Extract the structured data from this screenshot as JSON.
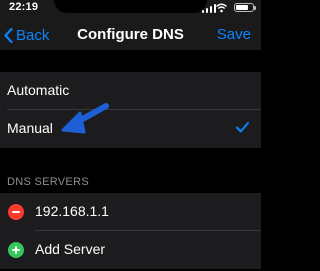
{
  "status_bar": {
    "time": "22:19"
  },
  "nav": {
    "back_label": "Back",
    "title": "Configure DNS",
    "save_label": "Save"
  },
  "dns_mode": {
    "options": [
      {
        "label": "Automatic",
        "selected": false
      },
      {
        "label": "Manual",
        "selected": true
      }
    ]
  },
  "dns_servers": {
    "header": "DNS SERVERS",
    "servers": [
      "192.168.1.1"
    ],
    "add_label": "Add Server"
  },
  "colors": {
    "accent": "#0a84ff",
    "delete": "#ff3b30",
    "add": "#34c759",
    "annotation_arrow": "#1f5fd6"
  },
  "icons": {
    "back": "chevron-left-icon",
    "selected": "checkmark-icon",
    "remove": "minus-circle-icon",
    "add": "plus-circle-icon",
    "annotation": "arrow-icon"
  }
}
